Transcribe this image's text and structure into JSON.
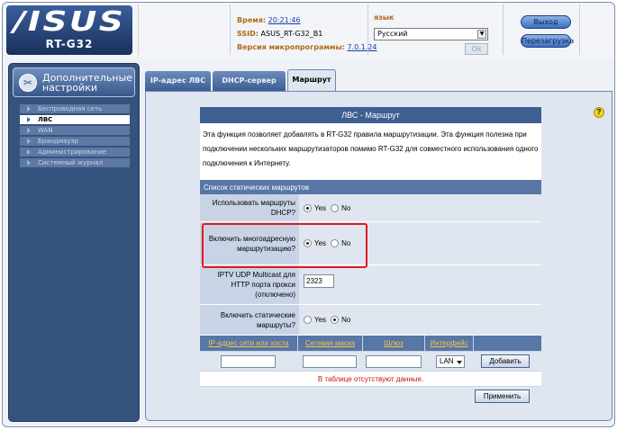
{
  "header": {
    "logo": "/ISUS",
    "model": "RT-G32",
    "time_label": "Время:",
    "time_value": "20:21:46",
    "ssid_label": "SSID:",
    "ssid_value": "ASUS_RT-G32_B1",
    "firmware_label": "Версия микропрограммы:",
    "firmware_value": "7.0.1.24",
    "language_label": "язык",
    "language_value": "Русский",
    "ok_label": "Ok",
    "logout_label": "Выход",
    "reboot_label": "Перезагрузка"
  },
  "sidebar": {
    "title": "Дополнительные настройки",
    "items": [
      {
        "label": "Беспроводная сеть",
        "active": false
      },
      {
        "label": "ЛВС",
        "active": true
      },
      {
        "label": "WAN",
        "active": false
      },
      {
        "label": "Брандмауэр",
        "active": false
      },
      {
        "label": "Администрирование",
        "active": false
      },
      {
        "label": "Системный журнал",
        "active": false
      }
    ]
  },
  "tabs": [
    {
      "label": "IP-адрес ЛВС",
      "selected": false
    },
    {
      "label": "DHCP-сервер",
      "selected": false
    },
    {
      "label": "Маршрут",
      "selected": true
    }
  ],
  "main": {
    "title": "ЛВС - Маршрут",
    "description": "Эта функция позволяет добавлять в RT-G32 правила маршрутизации. Эта функция полезна при подключении нескольких маршрутизаторов помимо RT-G32 для совместного использования одного подключения к Интернету.",
    "section_title": "Список статических маршрутов",
    "fields": {
      "use_dhcp_routes": {
        "label": "Использовать маршруты DHCP?",
        "yes": "Yes",
        "no": "No",
        "value": "Yes"
      },
      "enable_multicast": {
        "label": "Включить многоадресную маршрутизацию?",
        "yes": "Yes",
        "no": "No",
        "value": "Yes"
      },
      "udp_proxy": {
        "label": "IPTV UDP Multicast для HTTP порта прокси (отключено)",
        "value": "2323"
      },
      "enable_static": {
        "label": "Включить статические маршруты?",
        "yes": "Yes",
        "no": "No",
        "value": "No"
      }
    },
    "columns": [
      "IP-адрес сети или хоста",
      "Сетевая маска",
      "Шлюз",
      "Интерфейс"
    ],
    "interface_value": "LAN",
    "add_label": "Добавить",
    "empty_message": "В таблице отсутствуют данные.",
    "apply_label": "Применить"
  },
  "colors": {
    "accent": "#3e5f92",
    "sidebar": "#35537f",
    "highlight": "#e01a22",
    "warning": "#cc1111"
  }
}
